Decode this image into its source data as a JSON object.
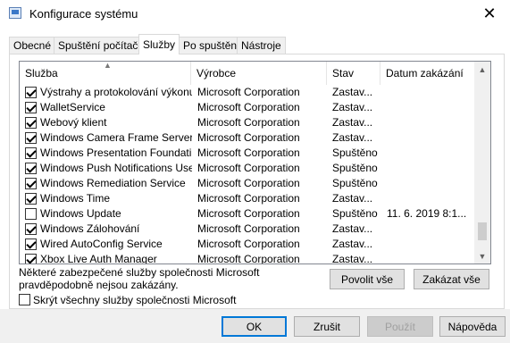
{
  "window": {
    "title": "Konfigurace systému",
    "close_glyph": "✕",
    "icon": "msconfig-icon"
  },
  "tabs": [
    {
      "label": "Obecné",
      "active": false
    },
    {
      "label": "Spuštění počítače",
      "active": false
    },
    {
      "label": "Služby",
      "active": true
    },
    {
      "label": "Po spuštění",
      "active": false
    },
    {
      "label": "Nástroje",
      "active": false
    }
  ],
  "services": {
    "headers": {
      "name": "Služba",
      "vendor": "Výrobce",
      "state": "Stav",
      "disabled_date": "Datum zakázání"
    },
    "sort_indicator": "▲",
    "rows": [
      {
        "checked": true,
        "name": "Výstrahy a protokolování výkonu",
        "vendor": "Microsoft Corporation",
        "state": "Zastav...",
        "date": ""
      },
      {
        "checked": true,
        "name": "WalletService",
        "vendor": "Microsoft Corporation",
        "state": "Zastav...",
        "date": ""
      },
      {
        "checked": true,
        "name": "Webový klient",
        "vendor": "Microsoft Corporation",
        "state": "Zastav...",
        "date": ""
      },
      {
        "checked": true,
        "name": "Windows Camera Frame Server",
        "vendor": "Microsoft Corporation",
        "state": "Zastav...",
        "date": ""
      },
      {
        "checked": true,
        "name": "Windows Presentation Foundati...",
        "vendor": "Microsoft Corporation",
        "state": "Spuštěno",
        "date": ""
      },
      {
        "checked": true,
        "name": "Windows Push Notifications User...",
        "vendor": "Microsoft Corporation",
        "state": "Spuštěno",
        "date": ""
      },
      {
        "checked": true,
        "name": "Windows Remediation Service",
        "vendor": "Microsoft Corporation",
        "state": "Spuštěno",
        "date": ""
      },
      {
        "checked": true,
        "name": "Windows Time",
        "vendor": "Microsoft Corporation",
        "state": "Zastav...",
        "date": ""
      },
      {
        "checked": false,
        "name": "Windows Update",
        "vendor": "Microsoft Corporation",
        "state": "Spuštěno",
        "date": "11. 6. 2019 8:1..."
      },
      {
        "checked": true,
        "name": "Windows Zálohování",
        "vendor": "Microsoft Corporation",
        "state": "Zastav...",
        "date": ""
      },
      {
        "checked": true,
        "name": "Wired AutoConfig Service",
        "vendor": "Microsoft Corporation",
        "state": "Zastav...",
        "date": ""
      },
      {
        "checked": true,
        "name": "Xbox Live Auth Manager",
        "vendor": "Microsoft Corporation",
        "state": "Zastav...",
        "date": ""
      }
    ],
    "scroll_up_glyph": "▲",
    "scroll_down_glyph": "▼"
  },
  "note": "Některé zabezpečené služby společnosti Microsoft pravděpodobně nejsou zakázány.",
  "buttons": {
    "enable_all": "Povolit vše",
    "disable_all": "Zakázat vše",
    "ok": "OK",
    "cancel": "Zrušit",
    "apply": "Použít",
    "help": "Nápověda"
  },
  "hide_ms": {
    "label": "Skrýt všechny služby společnosti Microsoft",
    "checked": false
  }
}
